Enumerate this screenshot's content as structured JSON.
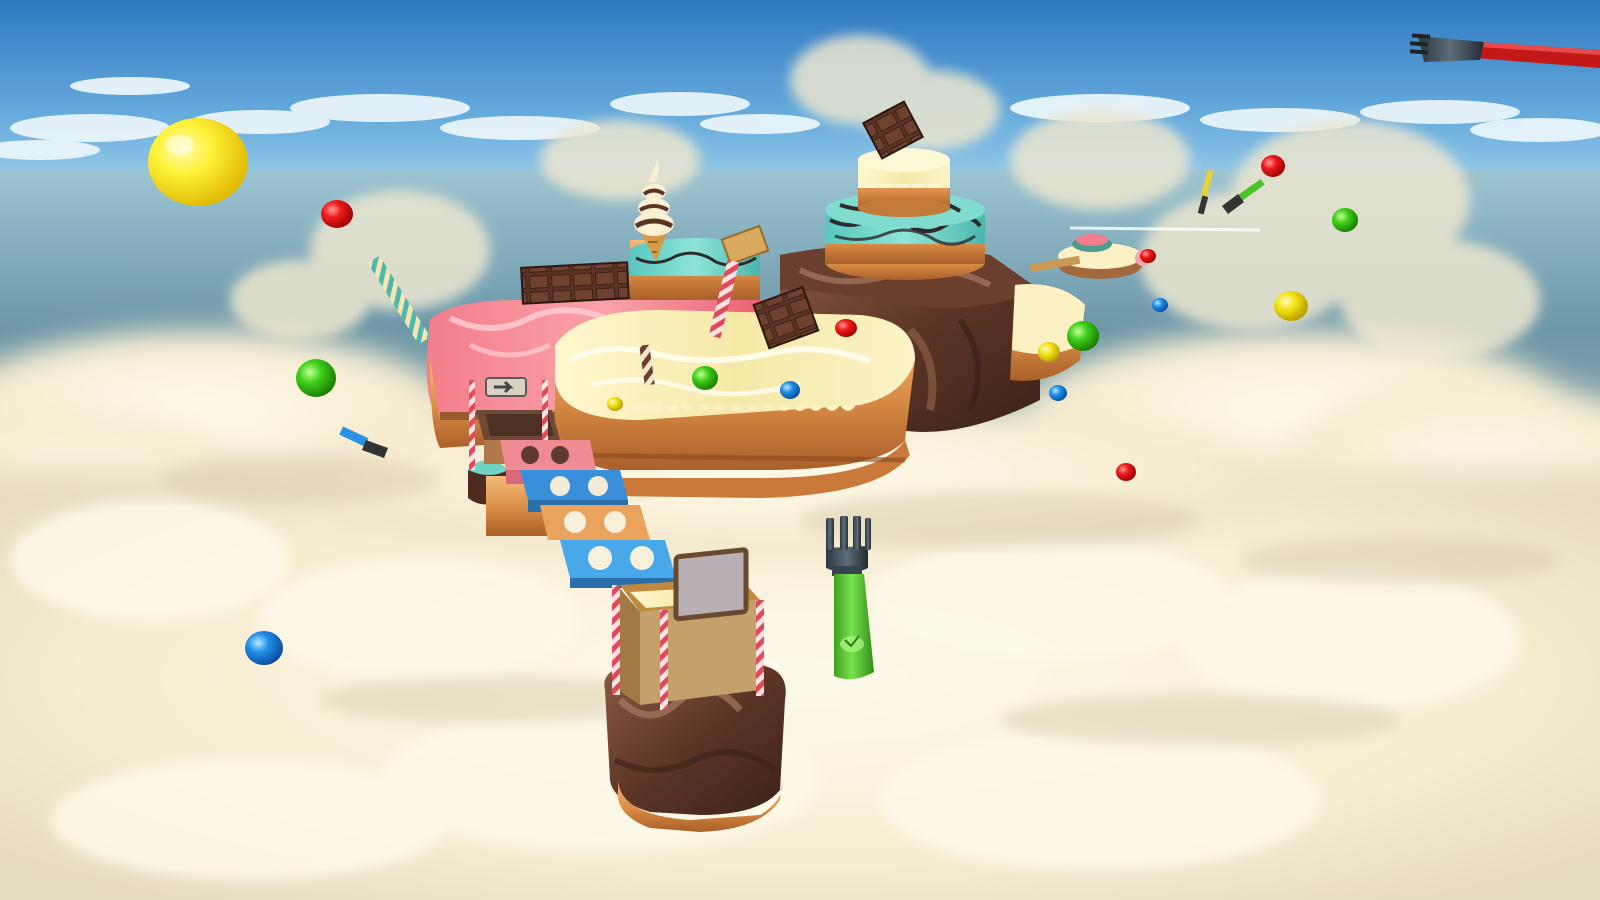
{
  "scene": {
    "type": "3d-platformer-viewport",
    "theme": "dessert-sky-island",
    "hud": {},
    "colors": {
      "sky_top": "#2f7fc4",
      "sky_horizon": "#a8d8ee",
      "sea": "#6f98a8",
      "cloud": "#fbf4dd",
      "frosting_pink": "#f06a7a",
      "frosting_cream": "#f9f0b8",
      "frosting_mint": "#6fd6c8",
      "chocolate": "#5a3326",
      "sponge": "#e9a35c",
      "fork_handle_green": "#5bd23a",
      "fork_handle_red": "#c81e1e"
    },
    "candy_colors": [
      "red",
      "green",
      "blue",
      "yellow"
    ],
    "objects": {
      "main_island": "layered-cake-island",
      "tower_cake": "mint-cream-stacked-cake",
      "bridge": "cake-block-bridge",
      "pillar": "chocolate-cake-pillar",
      "ice_cream": "soft-serve-cone",
      "collectible_fork": "green-handled-fork",
      "distant_fork": "red-handled-fork",
      "balloon": "yellow-balloon",
      "distant_island": "small-cake-platform"
    }
  }
}
